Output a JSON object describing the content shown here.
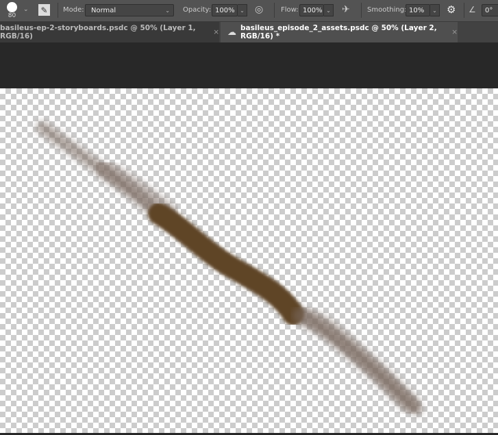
{
  "toolbar": {
    "brush_size": "80",
    "mode_label": "Mode:",
    "mode_value": "Normal",
    "opacity_label": "Opacity:",
    "opacity_value": "100%",
    "flow_label": "Flow:",
    "flow_value": "100%",
    "smoothing_label": "Smoothing:",
    "smoothing_value": "10%",
    "angle_value": "0°"
  },
  "tabs": [
    {
      "label": "basileus-ep-2-storyboards.psdc @ 50% (Layer 1, RGB/16)",
      "active": false
    },
    {
      "label": "basileus_episode_2_assets.psdc @ 50% (Layer 2, RGB/16) *",
      "active": true
    }
  ],
  "colors": {
    "stroke": "#5e4428",
    "stroke_soft": "#7a6a60"
  }
}
